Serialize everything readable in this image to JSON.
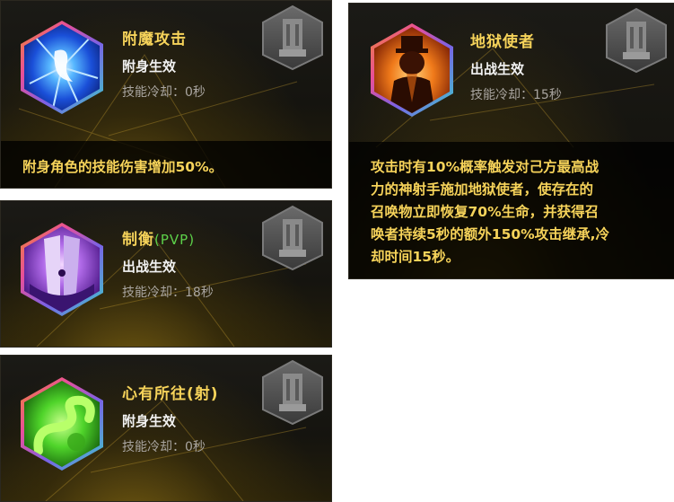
{
  "skills": [
    {
      "name": "附魔攻击",
      "type": "附身生效",
      "cooldown": "技能冷却：0秒",
      "description": "附身角色的技能伤害增加50%。",
      "icon": "lightning-spirit-icon"
    },
    {
      "name": "制衡",
      "name_tag": "(PVP)",
      "type": "出战生效",
      "cooldown": "技能冷却：18秒",
      "icon": "purple-shield-icon"
    },
    {
      "name": "心有所往(射)",
      "type": "附身生效",
      "cooldown": "技能冷却：0秒",
      "icon": "green-serpent-icon"
    },
    {
      "name": "地狱使者",
      "type": "出战生效",
      "cooldown": "技能冷却：15秒",
      "description_lines": [
        "攻击时有10%概率触发对己方最高战",
        "力的神射手施加地狱使者，使存在的",
        "召唤物立即恢复70%生命，并获得召",
        "唤者持续5秒的额外150%攻击继承,冷",
        "却时间15秒。"
      ],
      "icon": "hell-envoy-icon"
    }
  ],
  "colors": {
    "title": "#f6d35a",
    "pvp_tag": "#5dd14a",
    "type_text": "#f2f2f2",
    "cooldown_text": "#a9a5a0"
  }
}
